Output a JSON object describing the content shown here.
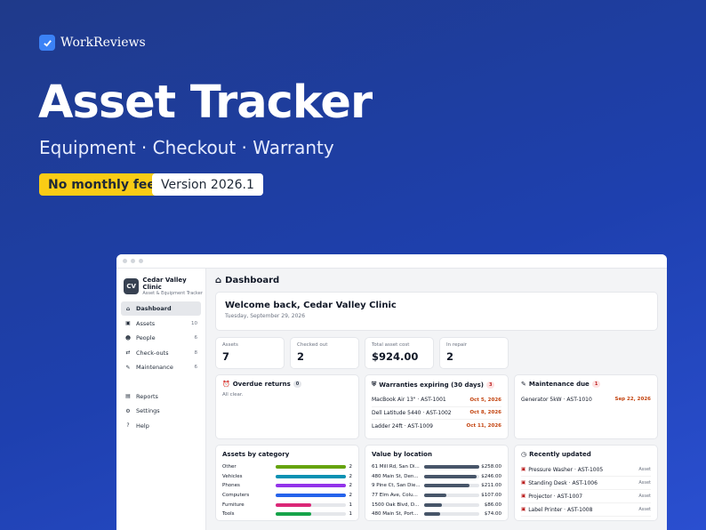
{
  "brand": {
    "name": "WorkReviews"
  },
  "hero": {
    "title": "Asset Tracker",
    "subtitle": "Equipment · Checkout · Warranty",
    "pill_primary": "No monthly fee",
    "pill_secondary": "Version 2026.1"
  },
  "app": {
    "org_initials": "CV",
    "org_name": "Cedar Valley Clinic",
    "org_sub": "Asset & Equipment Tracker",
    "nav": [
      {
        "label": "Dashboard",
        "icon": "home-icon",
        "glyph": "⌂",
        "count": ""
      },
      {
        "label": "Assets",
        "icon": "toolbox-icon",
        "glyph": "▣",
        "count": "10"
      },
      {
        "label": "People",
        "icon": "person-icon",
        "glyph": "☻",
        "count": "6"
      },
      {
        "label": "Check-outs",
        "icon": "swap-icon",
        "glyph": "⇄",
        "count": "8"
      },
      {
        "label": "Maintenance",
        "icon": "wrench-icon",
        "glyph": "✎",
        "count": "6"
      }
    ],
    "nav_secondary": [
      {
        "label": "Reports",
        "icon": "chart-icon",
        "glyph": "▤"
      },
      {
        "label": "Settings",
        "icon": "gear-icon",
        "glyph": "⚙"
      },
      {
        "label": "Help",
        "icon": "question-icon",
        "glyph": "?"
      }
    ],
    "page_title": "Dashboard",
    "welcome_title": "Welcome back, Cedar Valley Clinic",
    "welcome_date": "Tuesday, September 29, 2026",
    "stats": [
      {
        "label": "Assets",
        "value": "7"
      },
      {
        "label": "Checked out",
        "value": "2"
      },
      {
        "label": "Total asset cost",
        "value": "$924.00"
      },
      {
        "label": "In repair",
        "value": "2"
      }
    ],
    "overdue": {
      "title": "Overdue returns",
      "count": "0",
      "empty": "All clear."
    },
    "warranties": {
      "title": "Warranties expiring (30 days)",
      "count": "3",
      "items": [
        {
          "name": "MacBook Air 13\" · AST-1001",
          "date": "Oct 5, 2026"
        },
        {
          "name": "Dell Latitude 5440 · AST-1002",
          "date": "Oct 8, 2026"
        },
        {
          "name": "Ladder 24ft · AST-1009",
          "date": "Oct 11, 2026"
        }
      ]
    },
    "maintenance": {
      "title": "Maintenance due",
      "count": "1",
      "items": [
        {
          "name": "Generator 5kW · AST-1010",
          "date": "Sep 22, 2026"
        }
      ]
    },
    "categories": {
      "title": "Assets by category",
      "items": [
        {
          "label": "Other",
          "value": "2",
          "frac": 1.0,
          "color": "#65a30d"
        },
        {
          "label": "Vehicles",
          "value": "2",
          "frac": 1.0,
          "color": "#0891b2"
        },
        {
          "label": "Phones",
          "value": "2",
          "frac": 1.0,
          "color": "#9333ea"
        },
        {
          "label": "Computers",
          "value": "2",
          "frac": 1.0,
          "color": "#2563eb"
        },
        {
          "label": "Furniture",
          "value": "1",
          "frac": 0.5,
          "color": "#db2777"
        },
        {
          "label": "Tools",
          "value": "1",
          "frac": 0.5,
          "color": "#16a34a"
        }
      ]
    },
    "locations": {
      "title": "Value by location",
      "items": [
        {
          "label": "61 Mill Rd, San Di...",
          "value": "$258.00",
          "frac": 1.0
        },
        {
          "label": "480 Main St, Den...",
          "value": "$246.00",
          "frac": 0.95
        },
        {
          "label": "9 Pine Ct, San Die...",
          "value": "$211.00",
          "frac": 0.82
        },
        {
          "label": "77 Elm Ave, Colu...",
          "value": "$107.00",
          "frac": 0.41
        },
        {
          "label": "1500 Oak Blvd, D...",
          "value": "$86.00",
          "frac": 0.33
        },
        {
          "label": "480 Main St, Port...",
          "value": "$74.00",
          "frac": 0.29
        }
      ],
      "color": "#475569"
    },
    "recent": {
      "title": "Recently updated",
      "items": [
        {
          "name": "Pressure Washer · AST-1005",
          "tag": "Asset"
        },
        {
          "name": "Standing Desk · AST-1006",
          "tag": "Asset"
        },
        {
          "name": "Projector · AST-1007",
          "tag": "Asset"
        },
        {
          "name": "Label Printer · AST-1008",
          "tag": "Asset"
        }
      ]
    }
  }
}
